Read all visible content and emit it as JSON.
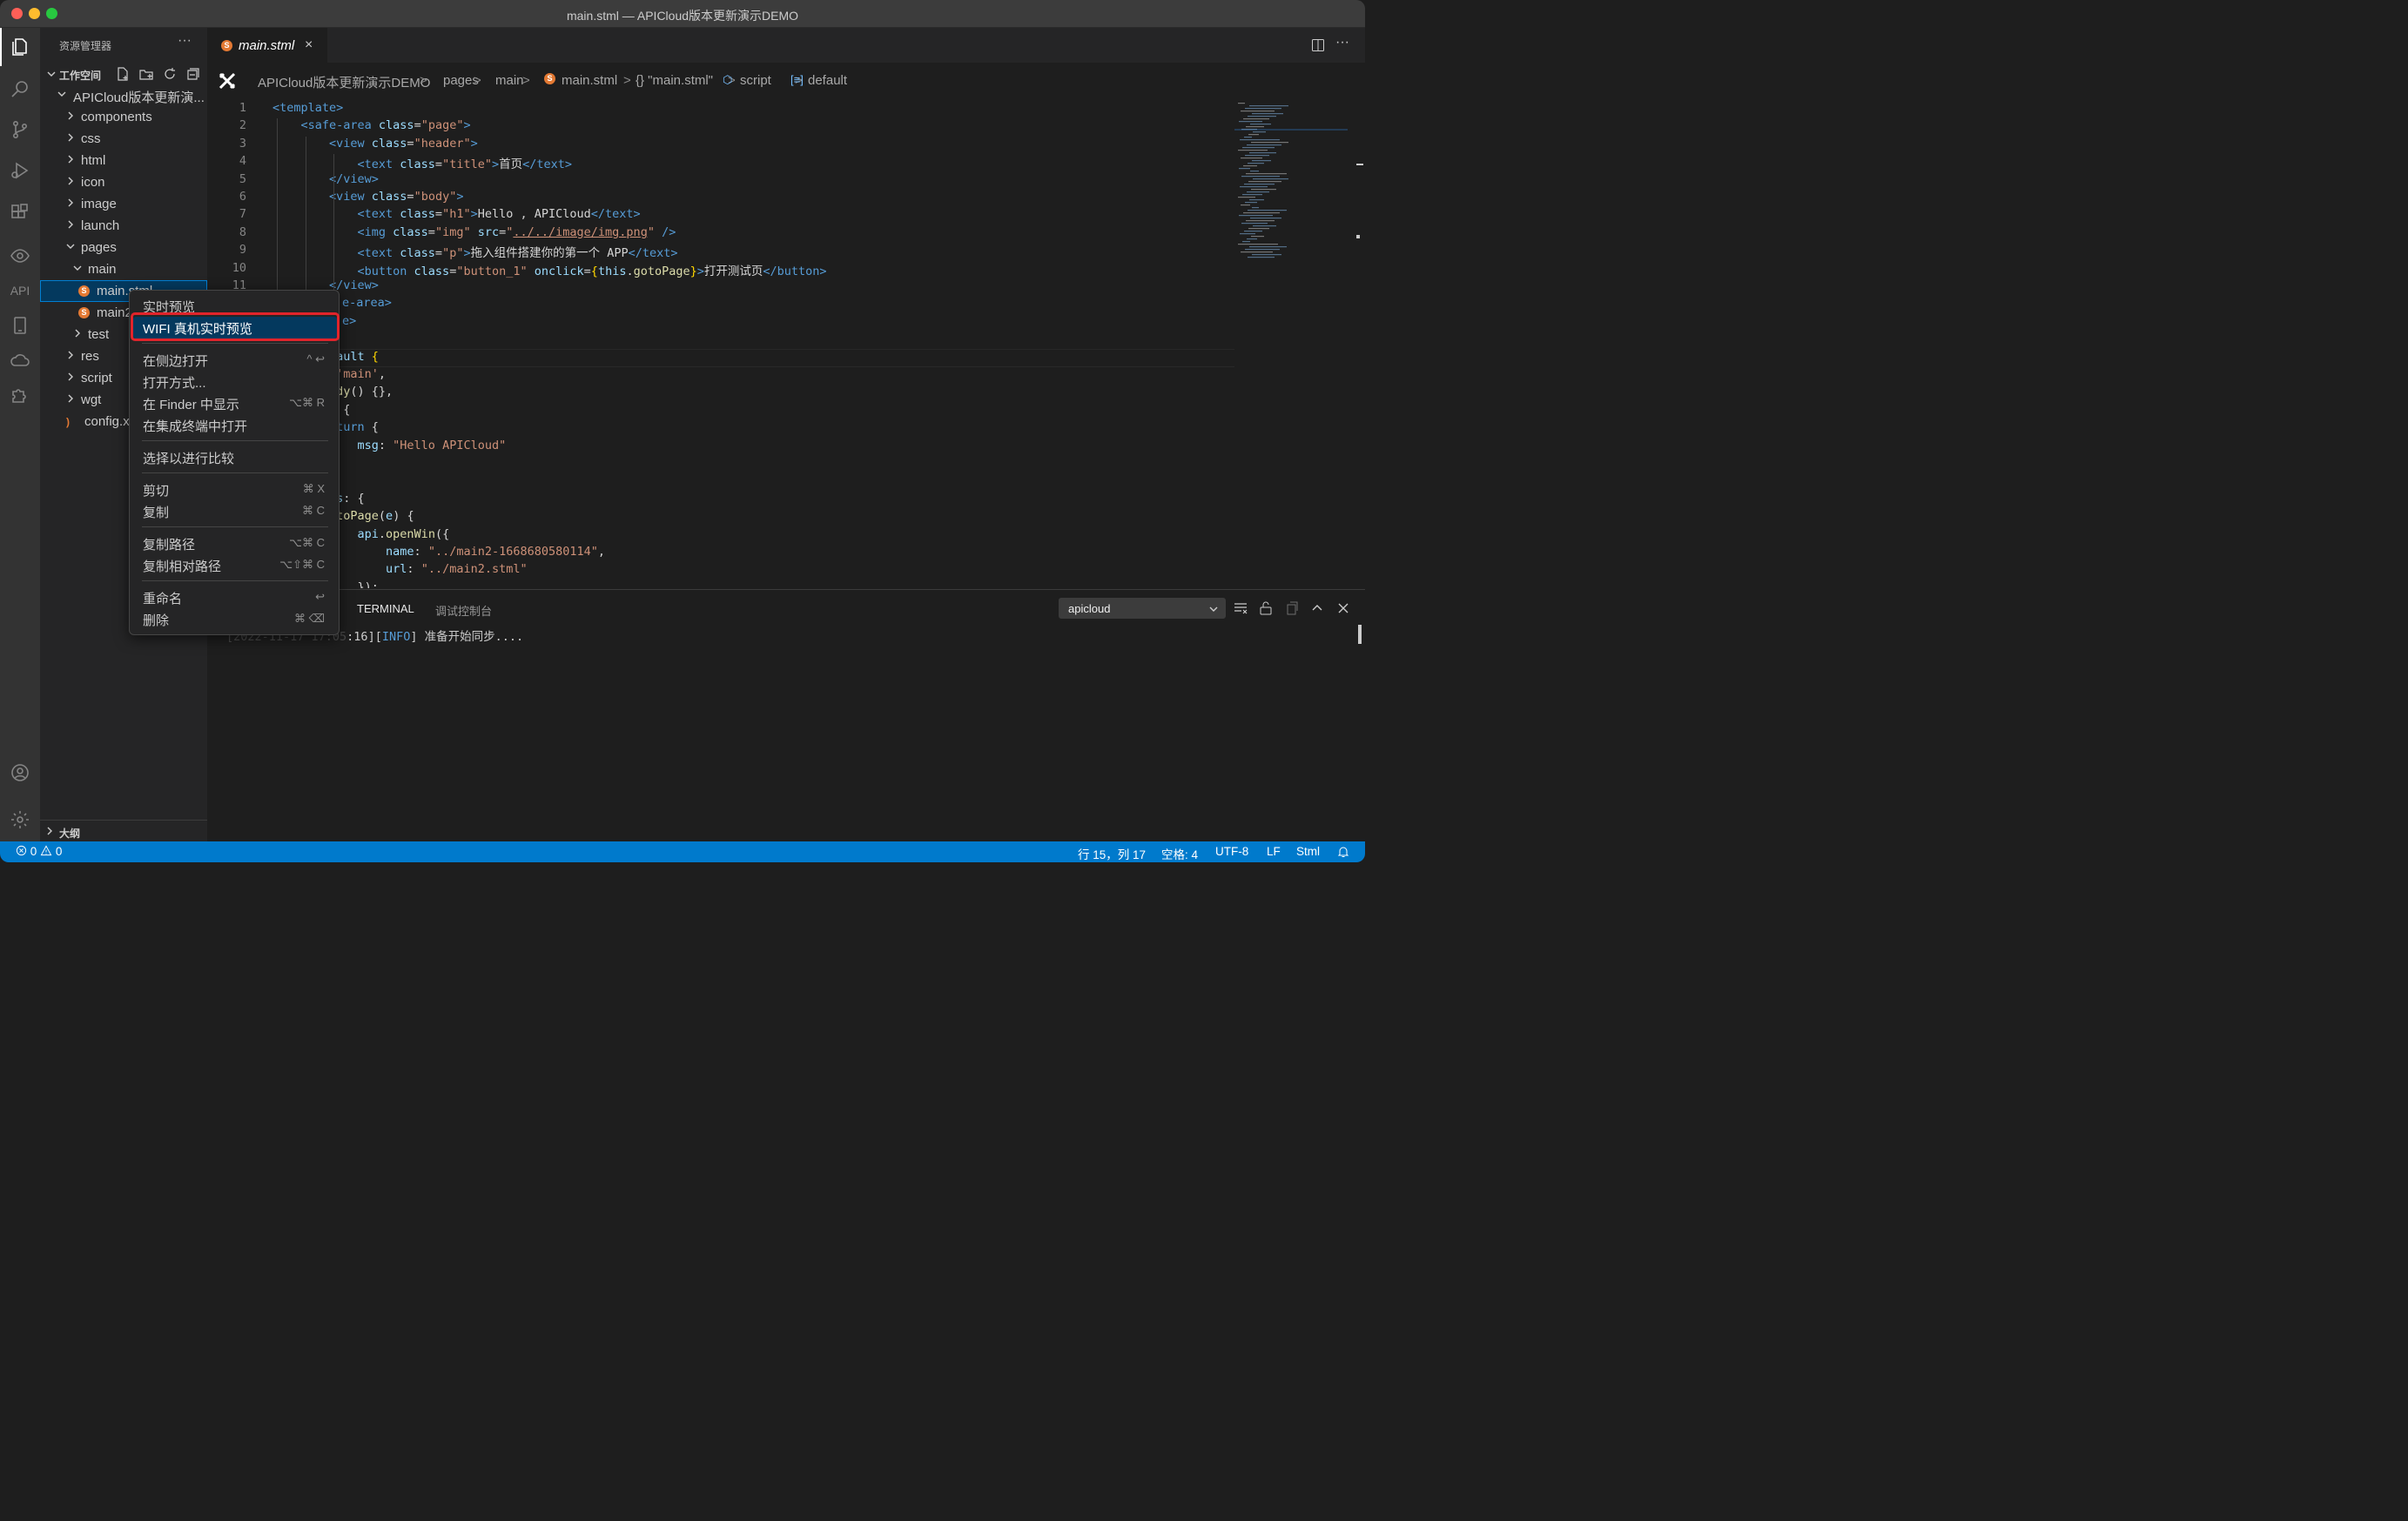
{
  "window": {
    "title": "main.stml — APICloud版本更新演示DEMO"
  },
  "colors": {
    "accent": "#007acc",
    "highlight_border": "#e0242b",
    "menu_selected": "#04395e"
  },
  "activity_bar": {
    "items": [
      "files-icon",
      "search-icon",
      "source-control-icon",
      "run-debug-icon",
      "extensions-icon",
      "eye-icon",
      "API",
      "device-icon",
      "cloud-icon",
      "puzzle-icon"
    ],
    "api_label": "API",
    "bottom": [
      "account-icon",
      "settings-gear-icon"
    ]
  },
  "sidebar": {
    "header": "资源管理器",
    "more": "···",
    "workspace": "工作空间",
    "project": "APICloud版本更新演...",
    "tree": [
      {
        "label": "components",
        "depth": 1,
        "expanded": false
      },
      {
        "label": "css",
        "depth": 1,
        "expanded": false
      },
      {
        "label": "html",
        "depth": 1,
        "expanded": false
      },
      {
        "label": "icon",
        "depth": 1,
        "expanded": false
      },
      {
        "label": "image",
        "depth": 1,
        "expanded": false
      },
      {
        "label": "launch",
        "depth": 1,
        "expanded": false
      },
      {
        "label": "pages",
        "depth": 1,
        "expanded": true
      },
      {
        "label": "main",
        "depth": 2,
        "expanded": true
      },
      {
        "label": "main.stml",
        "depth": 3,
        "file": true,
        "selected": true
      },
      {
        "label": "main2.stml",
        "depth": 3,
        "file": true
      },
      {
        "label": "test",
        "depth": 2,
        "expanded": false
      },
      {
        "label": "res",
        "depth": 1,
        "expanded": false
      },
      {
        "label": "script",
        "depth": 1,
        "expanded": false
      },
      {
        "label": "wgt",
        "depth": 1,
        "expanded": false
      },
      {
        "label": "config.xml",
        "depth": 1,
        "file": true,
        "rss": true
      }
    ],
    "outline": "大纲"
  },
  "editor": {
    "tab": {
      "label": "main.stml",
      "icon": "S",
      "close": "×"
    },
    "breadcrumb": [
      "APICloud版本更新演示DEMO",
      "pages",
      "main",
      "main.stml",
      "{} \"main.stml\"",
      "script",
      "default"
    ],
    "sep": ">",
    "line_numbers": [
      "1",
      "2",
      "3",
      "4",
      "5",
      "6",
      "7",
      "8",
      "9",
      "10",
      "11"
    ],
    "code_tail_lines": [
      "fault {",
      " 'main',",
      "ady() {},",
      ") {",
      "eturn {",
      "    msg: \"Hello APICloud\"",
      "",
      "",
      "ds: {",
      "otoPage(e) {",
      "    api.openWin({",
      "        name: \"../main2-1668680580114\",",
      "        url: \"../main2.stml\"",
      "    });"
    ]
  },
  "panel": {
    "tabs": [
      "TERMINAL",
      "调试控制台"
    ],
    "terminal_select": "apicloud",
    "log": {
      "time": ":16",
      "level": "INFO",
      "message": "准备开始同步...."
    }
  },
  "context_menu": {
    "items": [
      {
        "label": "实时预览",
        "key": ""
      },
      {
        "label": "WIFI 真机实时预览",
        "key": "",
        "selected": true
      },
      {
        "sep": true
      },
      {
        "label": "在侧边打开",
        "key": "^ ↩"
      },
      {
        "label": "打开方式...",
        "key": ""
      },
      {
        "label": "在 Finder 中显示",
        "key": "⌥⌘ R"
      },
      {
        "label": "在集成终端中打开",
        "key": ""
      },
      {
        "sep": true
      },
      {
        "label": "选择以进行比较",
        "key": ""
      },
      {
        "sep": true
      },
      {
        "label": "剪切",
        "key": "⌘ X"
      },
      {
        "label": "复制",
        "key": "⌘ C"
      },
      {
        "sep": true
      },
      {
        "label": "复制路径",
        "key": "⌥⌘ C"
      },
      {
        "label": "复制相对路径",
        "key": "⌥⇧⌘ C"
      },
      {
        "sep": true
      },
      {
        "label": "重命名",
        "key": "↩"
      },
      {
        "label": "删除",
        "key": "⌘ ⌫"
      }
    ]
  },
  "status_bar": {
    "errors": "0",
    "warnings": "0",
    "position": "行 15，列 17",
    "spaces": "空格: 4",
    "encoding": "UTF-8",
    "eol": "LF",
    "language": "Stml"
  }
}
